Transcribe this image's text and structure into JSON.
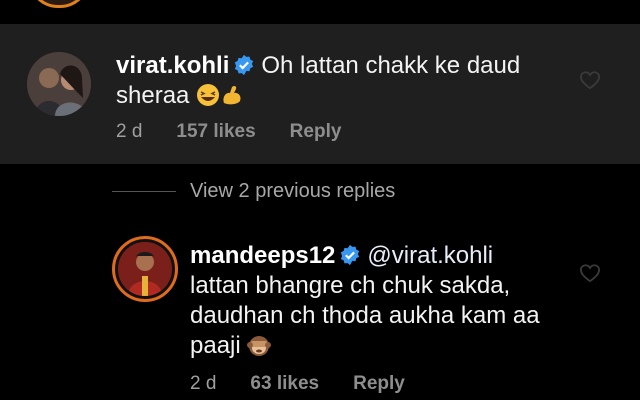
{
  "comments": [
    {
      "username": "virat.kohli",
      "text_line1": "Oh lattan chakk ke daud",
      "text_line2": "sheraa",
      "time": "2 d",
      "likes": "157 likes",
      "reply_label": "Reply",
      "emojis": [
        "laughing-emoji",
        "flexed-biceps-emoji"
      ]
    },
    {
      "username": "mandeeps12",
      "mention": "@virat.kohli",
      "text_line1": "lattan bhangre ch chuk sakda,",
      "text_line2": "daudhan ch thoda aukha kam aa",
      "text_line3": "paaji",
      "time": "2 d",
      "likes": "63 likes",
      "reply_label": "Reply",
      "emojis": [
        "see-no-evil-monkey-emoji"
      ]
    }
  ],
  "view_replies": "View 2 previous replies",
  "colors": {
    "background": "#000000",
    "highlight": "#1f1f1f",
    "verified": "#3897f0",
    "story_ring": "#e06b1c"
  }
}
